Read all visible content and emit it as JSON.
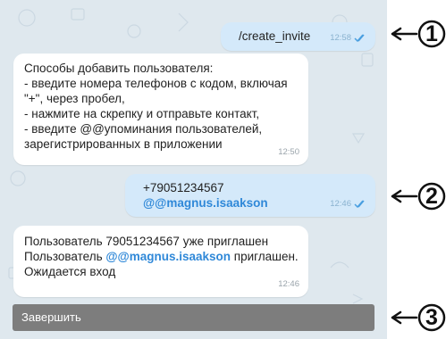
{
  "messages": {
    "command": {
      "text": "/create_invite",
      "time": "12:58"
    },
    "help": {
      "lines": [
        "Способы добавить пользователя:",
        "- введите номера телефонов с кодом, включая",
        "\"+\", через пробел,",
        "- нажмите на скрепку и отправьте контакт,",
        "- введите @@упоминания пользователей,",
        "зарегистрированных в приложении"
      ],
      "time": "12:50"
    },
    "invite": {
      "phone": "+79051234567",
      "mention": "@@magnus.isaakson",
      "time": "12:46"
    },
    "result": {
      "line1": "Пользователь 79051234567 уже приглашен",
      "line2_prefix": "Пользователь",
      "line2_mention": "@@magnus.isaakson",
      "line2_suffix": "приглашен.",
      "line3": "Ожидается вход",
      "time": "12:46"
    }
  },
  "finish_button": {
    "label": "Завершить"
  },
  "callouts": [
    "1",
    "2",
    "3"
  ],
  "colors": {
    "chat_background": "#dfe8ee",
    "incoming_bubble": "#ffffff",
    "outgoing_bubble": "#d4e9fa",
    "mention": "#2f88d8",
    "read_check": "#4a9fe0",
    "finish_button": "#7d7d7d"
  },
  "icons": {
    "read_receipt": "double-check-icon",
    "callout_arrow": "arrow-left-icon"
  }
}
